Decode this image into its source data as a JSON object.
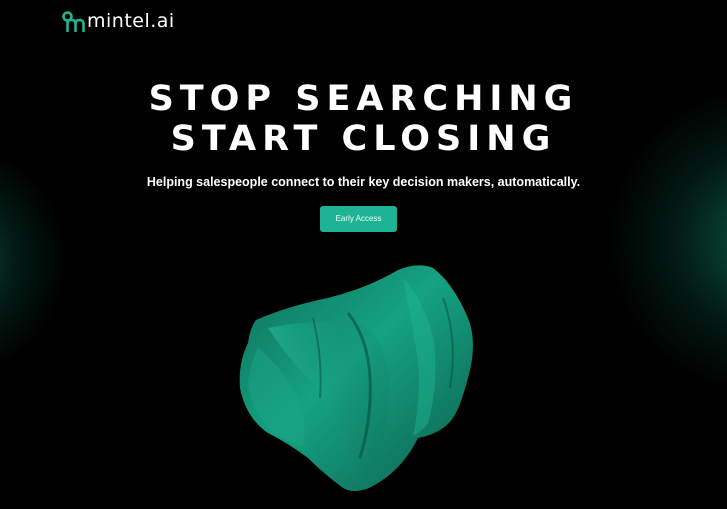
{
  "brand": {
    "name": "mintel.ai",
    "accent_color": "#1fb396"
  },
  "hero": {
    "title_line_1": "STOP SEARCHING",
    "title_line_2": "START CLOSING",
    "subtitle": "Helping salespeople connect to their key decision makers, automatically."
  },
  "cta": {
    "label": "Early Access"
  },
  "colors": {
    "background": "#000000",
    "text": "#ffffff",
    "accent": "#1fb396",
    "glow": "#0e6d55"
  }
}
